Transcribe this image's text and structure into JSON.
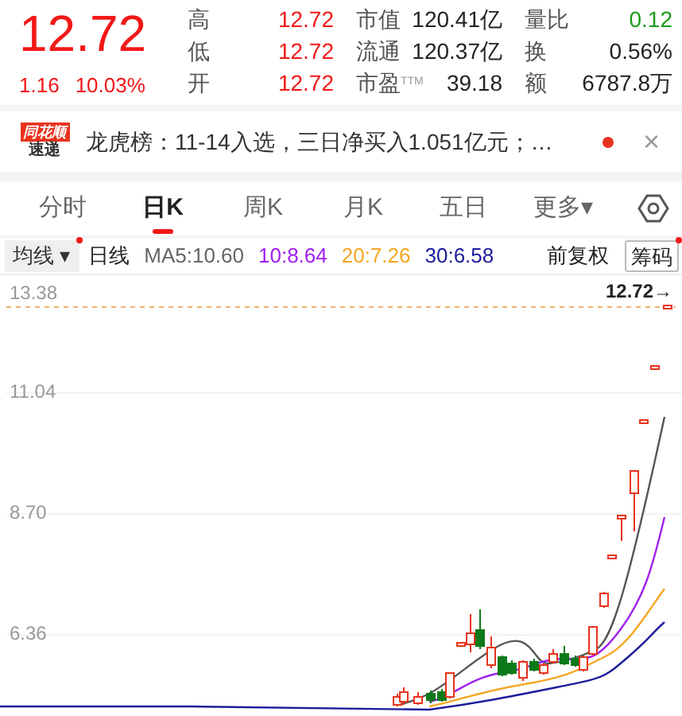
{
  "quote": {
    "price": "12.72",
    "change": "1.16",
    "change_pct": "10.03%"
  },
  "stats": [
    [
      {
        "label": "高",
        "value": "12.72",
        "color": "#f21818"
      },
      {
        "label": "市值",
        "value": "120.41亿",
        "color": "#222222"
      },
      {
        "label": "量比",
        "value": "0.12",
        "color": "#1a9a1a"
      }
    ],
    [
      {
        "label": "低",
        "value": "12.72",
        "color": "#f21818"
      },
      {
        "label": "流通",
        "value": "120.37亿",
        "color": "#222222"
      },
      {
        "label": "换",
        "value": "0.56%",
        "color": "#222222"
      }
    ],
    [
      {
        "label": "开",
        "value": "12.72",
        "color": "#f21818"
      },
      {
        "label": "市盈$^{TTM}$",
        "value": "39.18",
        "color": "#222222"
      },
      {
        "label": "额",
        "value": "6787.8万",
        "color": "#222222"
      }
    ]
  ],
  "news": {
    "logo_top": "同花顺",
    "logo_bottom": "速递",
    "text": "龙虎榜：11-14入选，三日净买入1.051亿元；…",
    "unread": true,
    "close": "×"
  },
  "tabs": [
    {
      "label": "分时",
      "selected": false
    },
    {
      "label": "日K",
      "selected": true
    },
    {
      "label": "周K",
      "selected": false
    },
    {
      "label": "月K",
      "selected": false
    },
    {
      "label": "五日",
      "selected": false
    },
    {
      "label": "更多▾",
      "selected": false
    }
  ],
  "indicator_bar": {
    "dropdown": "均线 ▾",
    "period": "日线",
    "ma": [
      {
        "label": "MA5:10.60",
        "color": "#666666"
      },
      {
        "label": "10:8.64",
        "color": "#a020f0"
      },
      {
        "label": "20:7.26",
        "color": "#f5a623"
      },
      {
        "label": "30:6.58",
        "color": "#1c1c9c"
      }
    ],
    "adjust": "前复权",
    "chips_button": "筹码"
  },
  "chart": {
    "y_labels": [
      "13.38",
      "11.04",
      "8.70",
      "6.36"
    ],
    "last_price": "12.72→"
  }
}
